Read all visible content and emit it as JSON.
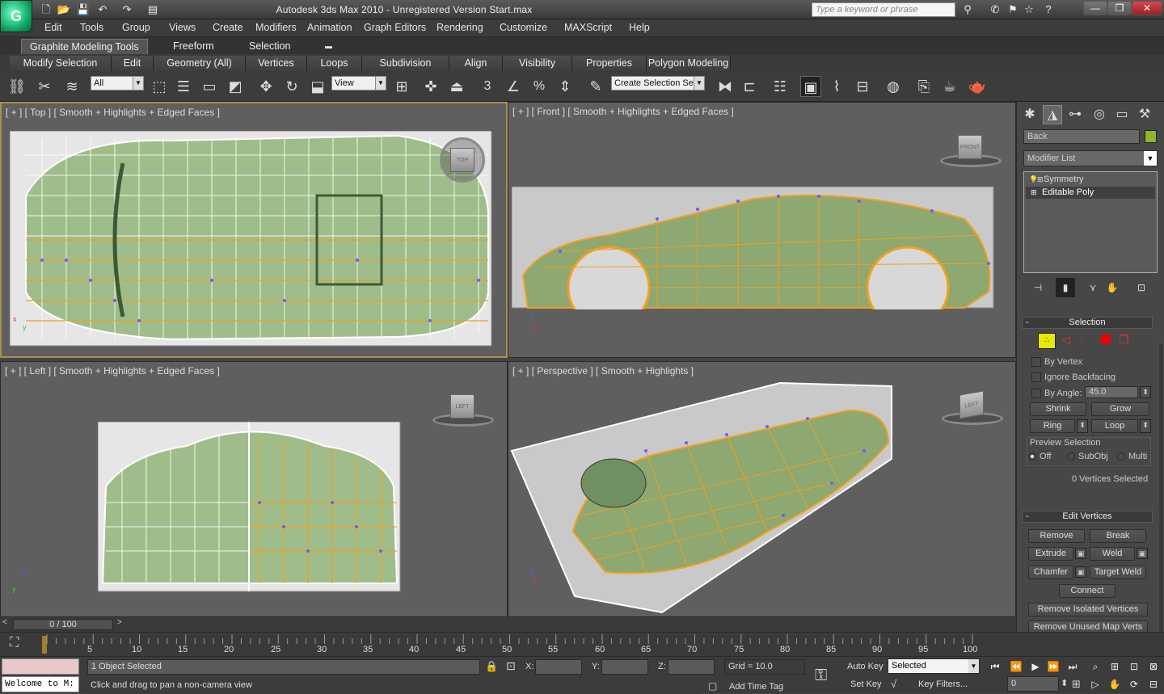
{
  "window": {
    "title": "Autodesk 3ds Max  2010  -  Unregistered Version      Start.max",
    "search_placeholder": "Type a keyword or phrase",
    "minimize": "—",
    "maximize": "❐",
    "close": "✕"
  },
  "menu": [
    "Edit",
    "Tools",
    "Group",
    "Views",
    "Create",
    "Modifiers",
    "Animation",
    "Graph Editors",
    "Rendering",
    "Customize",
    "MAXScript",
    "Help"
  ],
  "ribbon": {
    "tabs": [
      "Graphite Modeling Tools",
      "Freeform",
      "Selection"
    ],
    "subtabs": [
      "Modify Selection",
      "Edit",
      "Geometry (All)",
      "Vertices",
      "Loops",
      "Subdivision",
      "Align",
      "Visibility",
      "Properties",
      "Polygon Modeling"
    ]
  },
  "toolbar": {
    "filter": "All",
    "refcoord": "View",
    "named_selection": "Create Selection Se",
    "snap_label": "3",
    "angle_label": "%"
  },
  "viewports": {
    "top": {
      "label": "[ + ] [ Top ] [ Smooth + Highlights + Edged Faces ]",
      "cube": "TOP"
    },
    "front": {
      "label": "[ + ] [ Front ] [ Smooth + Highlights + Edged Faces ]",
      "cube": "FRONT"
    },
    "left": {
      "label": "[ + ] [ Left ] [ Smooth + Highlights + Edged Faces ]",
      "cube": "LEFT"
    },
    "persp": {
      "label": "[ + ] [ Perspective ] [ Smooth + Highlights ]",
      "cube": "LEFT"
    },
    "axis": {
      "x": "x",
      "y": "y",
      "z": "z"
    }
  },
  "command_panel": {
    "object_name": "Back",
    "object_color": "#8fb62a",
    "modifier_list": "Modifier List",
    "stack": [
      {
        "name": "Symmetry"
      },
      {
        "name": "Editable Poly"
      }
    ],
    "selection": {
      "title": "Selection",
      "by_vertex": "By Vertex",
      "ignore_backfacing": "Ignore Backfacing",
      "by_angle": "By Angle:",
      "angle_value": "45.0",
      "shrink": "Shrink",
      "grow": "Grow",
      "ring": "Ring",
      "loop": "Loop",
      "preview_selection": "Preview Selection",
      "preview_off": "Off",
      "preview_subobj": "SubObj",
      "preview_multi": "Multi",
      "status": "0 Vertices Selected"
    },
    "edit_vertices": {
      "title": "Edit Vertices",
      "remove": "Remove",
      "break": "Break",
      "extrude": "Extrude",
      "weld": "Weld",
      "chamfer": "Chamfer",
      "target_weld": "Target Weld",
      "connect": "Connect",
      "remove_isolated": "Remove Isolated Vertices",
      "remove_unused": "Remove Unused Map Verts"
    }
  },
  "timeline": {
    "slider": "0 / 100",
    "ticks": [
      "5",
      "10",
      "15",
      "20",
      "25",
      "30",
      "35",
      "40",
      "45",
      "50",
      "55",
      "60",
      "65",
      "70",
      "75",
      "80",
      "85",
      "90",
      "95",
      "100"
    ]
  },
  "status": {
    "listener": "Welcome to M:",
    "selected": "1 Object Selected",
    "prompt": "Click and drag to pan a non-camera view",
    "x_label": "X:",
    "y_label": "Y:",
    "z_label": "Z:",
    "grid": "Grid = 10.0",
    "add_time_tag": "Add Time Tag",
    "auto_key": "Auto Key",
    "set_key": "Set Key",
    "key_mode": "Selected",
    "key_filters": "Key Filters...",
    "frame": "0"
  }
}
